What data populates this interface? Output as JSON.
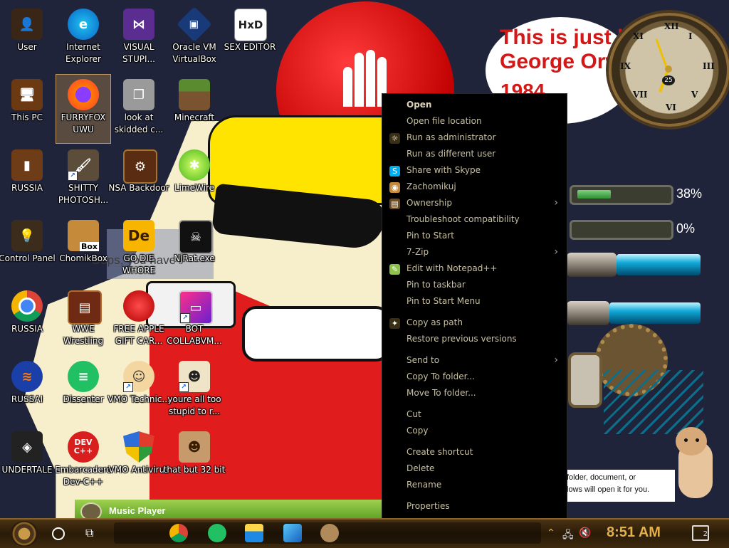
{
  "desktop": {
    "icons": [
      {
        "label": "User"
      },
      {
        "label": "Internet Explorer"
      },
      {
        "label": "VISUAL STUPI..."
      },
      {
        "label": "Oracle VM VirtualBox"
      },
      {
        "label": "SEX EDITOR"
      },
      {
        "label": "This PC"
      },
      {
        "label": "FURRYFOX UWU"
      },
      {
        "label": "look at skidded c..."
      },
      {
        "label": "Minecraft"
      },
      {
        "label": "RUSSIA"
      },
      {
        "label": "SHITTY PHOTOSH..."
      },
      {
        "label": "NSA Backdoor"
      },
      {
        "label": "LimeWire"
      },
      {
        "label": "Control Panel"
      },
      {
        "label": "ChomikBox"
      },
      {
        "label": "GO DIE WHORE"
      },
      {
        "label": "NjRat.exe"
      },
      {
        "label": "RUSSIA"
      },
      {
        "label": "WWE Wrestling"
      },
      {
        "label": "FREE APPLE GIFT CAR..."
      },
      {
        "label": "BOT COLLABVM..."
      },
      {
        "label": "RUSSAI"
      },
      {
        "label": "Dissenter"
      },
      {
        "label": "VMO Technic..."
      },
      {
        "label": "youre all too stupid to r..."
      },
      {
        "label": "UNDERTALE"
      },
      {
        "label": "Embarcadero Dev-C++"
      },
      {
        "label": "VMO Antivirus"
      },
      {
        "label": "that but 32 bit"
      }
    ],
    "icon_badges": {
      "box": "Box",
      "de": "De",
      "hxd": "HxD",
      "dev": "DEV C++"
    }
  },
  "wallpaper": {
    "quote_line1": "This is just like",
    "quote_line2": "George Orwell's",
    "quote_year": "1984",
    "oops_text": "Oops, you have",
    "clock_day": "25",
    "gauges": [
      {
        "percent_text": "38%",
        "fill": 0.38
      },
      {
        "percent_text": "0%",
        "fill": 0.0
      }
    ],
    "tooltip_line1": "folder, document, or",
    "tooltip_line2": "lows will open it for you.",
    "music_player_title": "Music Player"
  },
  "context_menu": {
    "items": [
      {
        "label": "Open",
        "bold": true,
        "icon": "",
        "submenu": false
      },
      {
        "label": "Open file location",
        "icon": "",
        "submenu": false
      },
      {
        "label": "Run as administrator",
        "icon": "shield-icon",
        "submenu": false
      },
      {
        "label": "Run as different user",
        "icon": "",
        "submenu": false
      },
      {
        "label": "Share with Skype",
        "icon": "skype-icon",
        "submenu": false
      },
      {
        "label": "Zachomikuj",
        "icon": "chomikuj-icon",
        "submenu": false
      },
      {
        "label": "Ownership",
        "icon": "ownership-icon",
        "submenu": true
      },
      {
        "label": "Troubleshoot compatibility",
        "icon": "",
        "submenu": false
      },
      {
        "label": "Pin to Start",
        "icon": "",
        "submenu": false
      },
      {
        "label": "7-Zip",
        "icon": "",
        "submenu": true
      },
      {
        "label": "Edit with Notepad++",
        "icon": "notepadpp-icon",
        "submenu": false
      },
      {
        "label": "Pin to taskbar",
        "icon": "",
        "submenu": false
      },
      {
        "label": "Pin to Start Menu",
        "icon": "",
        "submenu": false
      },
      {
        "label": "Copy as path",
        "icon": "copy-path-icon",
        "submenu": false
      },
      {
        "label": "Restore previous versions",
        "icon": "",
        "submenu": false
      },
      {
        "label": "Send to",
        "icon": "",
        "submenu": true
      },
      {
        "label": "Copy To folder...",
        "icon": "",
        "submenu": false
      },
      {
        "label": "Move To folder...",
        "icon": "",
        "submenu": false
      },
      {
        "label": "Cut",
        "icon": "",
        "submenu": false
      },
      {
        "label": "Copy",
        "icon": "",
        "submenu": false
      },
      {
        "label": "Create shortcut",
        "icon": "",
        "submenu": false
      },
      {
        "label": "Delete",
        "icon": "",
        "submenu": false
      },
      {
        "label": "Rename",
        "icon": "",
        "submenu": false
      },
      {
        "label": "Properties",
        "icon": "",
        "submenu": false
      }
    ]
  },
  "taskbar": {
    "time": "8:51 AM",
    "notification_count": "2",
    "pinned_apps": [
      "chrome-icon",
      "dissenter-icon",
      "file-explorer-icon",
      "remote-desktop-icon",
      "hamster-icon"
    ]
  }
}
